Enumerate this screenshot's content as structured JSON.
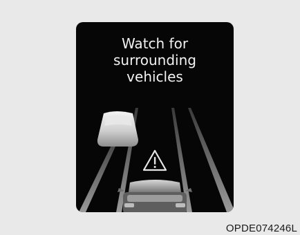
{
  "display": {
    "message_lines": [
      "Watch for",
      "surrounding",
      "vehicles"
    ],
    "icons": {
      "warning": "warning-triangle-icon",
      "side_vehicle": "side-vehicle-icon",
      "own_vehicle": "own-vehicle-icon"
    }
  },
  "caption": "OPDE074246L",
  "colors": {
    "page_background": "#e9e9e9",
    "screen_background": "#060606",
    "text": "#f2f2f2",
    "lane_line": "#8a8a8a"
  }
}
